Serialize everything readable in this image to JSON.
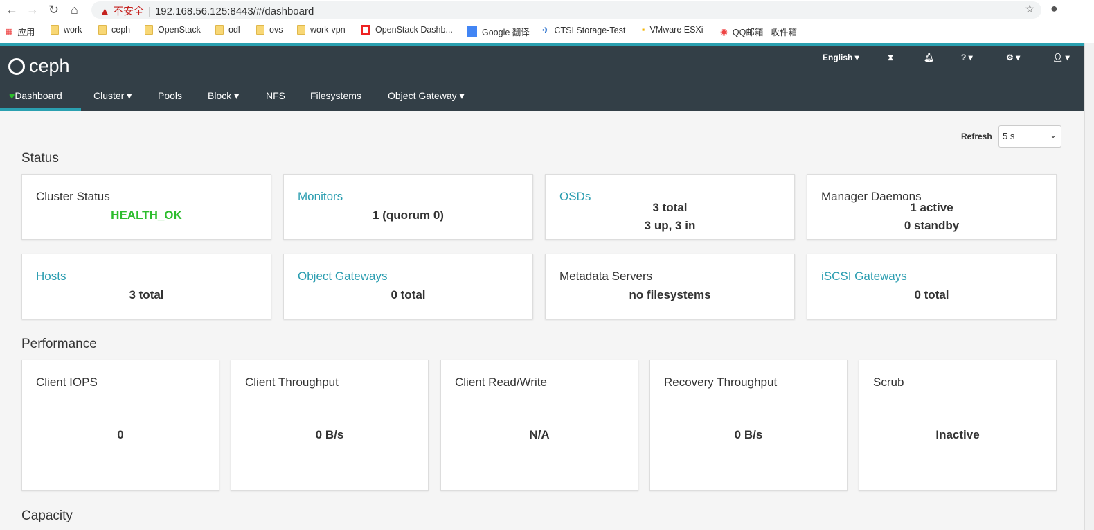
{
  "browser": {
    "warning": "不安全",
    "url": "192.168.56.125:8443/#/dashboard",
    "bookmarks": [
      "应用",
      "work",
      "ceph",
      "OpenStack",
      "odl",
      "ovs",
      "work-vpn",
      "OpenStack Dashb...",
      "Google 翻译",
      "CTSI Storage-Test",
      "VMware ESXi",
      "QQ邮箱 - 收件箱"
    ]
  },
  "navbar": {
    "brand": "ceph",
    "language": "English",
    "menu": [
      "Dashboard",
      "Cluster",
      "Pools",
      "Block",
      "NFS",
      "Filesystems",
      "Object Gateway"
    ]
  },
  "refresh": {
    "label": "Refresh",
    "value": "5 s"
  },
  "status": {
    "title": "Status",
    "cards": [
      {
        "title": "Cluster Status",
        "lines": [
          "HEALTH_OK"
        ]
      },
      {
        "title": "Monitors",
        "lines": [
          "1 (quorum 0)"
        ]
      },
      {
        "title": "OSDs",
        "lines": [
          "3 total",
          "3 up, 3 in"
        ]
      },
      {
        "title": "Manager Daemons",
        "lines": [
          "1 active",
          "0 standby"
        ]
      },
      {
        "title": "Hosts",
        "lines": [
          "3 total"
        ]
      },
      {
        "title": "Object Gateways",
        "lines": [
          "0 total"
        ]
      },
      {
        "title": "Metadata Servers",
        "lines": [
          "no filesystems"
        ]
      },
      {
        "title": "iSCSI Gateways",
        "lines": [
          "0 total"
        ]
      }
    ]
  },
  "performance": {
    "title": "Performance",
    "cards": [
      {
        "title": "Client IOPS",
        "value": "0"
      },
      {
        "title": "Client Throughput",
        "value": "0 B/s"
      },
      {
        "title": "Client Read/Write",
        "value": "N/A"
      },
      {
        "title": "Recovery Throughput",
        "value": "0 B/s"
      },
      {
        "title": "Scrub",
        "value": "Inactive"
      }
    ]
  },
  "capacity": {
    "title": "Capacity"
  },
  "colors": {
    "navbar": "#333f47",
    "accent": "#2aa0b0",
    "health_ok": "#2dbd2d"
  }
}
